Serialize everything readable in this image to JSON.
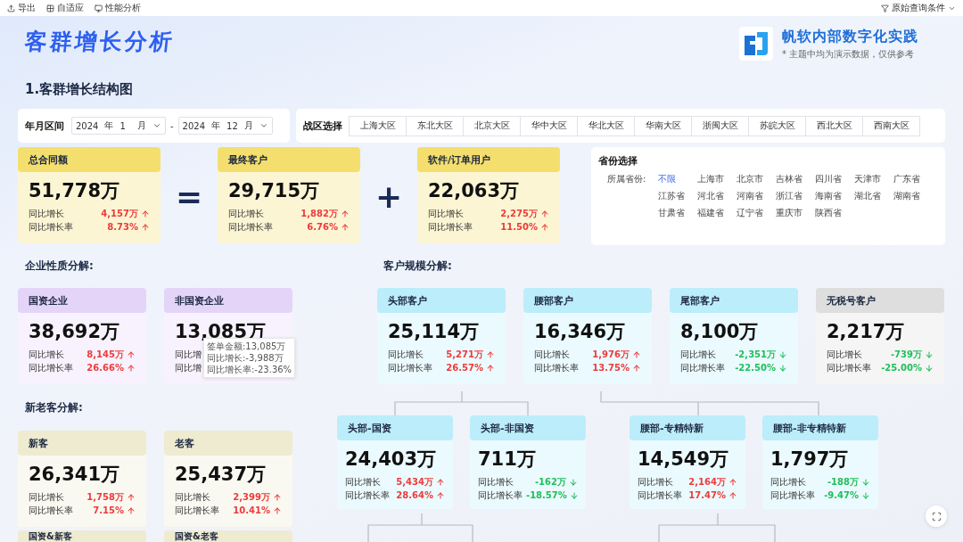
{
  "toolbar": {
    "left": [
      {
        "label": "导出"
      },
      {
        "label": "自适应"
      },
      {
        "label": "性能分析"
      }
    ],
    "right": {
      "label": "原始查询条件"
    }
  },
  "header": {
    "title": "客群增长分析",
    "brand": "帆软内部数字化实践",
    "note": "* 主题中均为演示数据，仅供参考"
  },
  "section_title": "1.客群增长结构图",
  "date_filter": {
    "label": "年月区间",
    "separator": "-",
    "ranges": [
      {
        "year": "2024",
        "year_unit": "年",
        "month": "1",
        "month_unit": "月"
      },
      {
        "year": "2024",
        "year_unit": "年",
        "month": "12",
        "month_unit": "月"
      }
    ]
  },
  "region_filter": {
    "label": "战区选择",
    "options": [
      {
        "label": "上海大区",
        "selected": false
      },
      {
        "label": "东北大区",
        "selected": false
      },
      {
        "label": "北京大区",
        "selected": false
      },
      {
        "label": "华中大区",
        "selected": false
      },
      {
        "label": "华北大区",
        "selected": false
      },
      {
        "label": "华南大区",
        "selected": false
      },
      {
        "label": "浙闽大区",
        "selected": false
      },
      {
        "label": "苏皖大区",
        "selected": false
      },
      {
        "label": "西北大区",
        "selected": false
      },
      {
        "label": "西南大区",
        "selected": false
      }
    ]
  },
  "summary": [
    {
      "kind": "card",
      "title": "总合同额",
      "color": "#f4df6e",
      "value": "51,778万",
      "stats": [
        {
          "label": "同比增长",
          "value": "4,157万",
          "increase": true
        },
        {
          "label": "同比增长率",
          "value": "8.73%",
          "increase": true
        }
      ]
    },
    {
      "kind": "operator",
      "symbol": "="
    },
    {
      "kind": "card",
      "title": "最终客户",
      "color": "#f4df6e",
      "value": "29,715万",
      "stats": [
        {
          "label": "同比增长",
          "value": "1,882万",
          "increase": true
        },
        {
          "label": "同比增长率",
          "value": "6.76%",
          "increase": true
        }
      ]
    },
    {
      "kind": "operator",
      "symbol": "+"
    },
    {
      "kind": "card",
      "title": "软件/订单用户",
      "color": "#f4df6e",
      "value": "22,063万",
      "stats": [
        {
          "label": "同比增长",
          "value": "2,275万",
          "increase": true
        },
        {
          "label": "同比增长率",
          "value": "11.50%",
          "increase": true
        }
      ]
    }
  ],
  "province_filter": {
    "title": "省份选择",
    "label": "所属省份:",
    "options": [
      {
        "label": "不限",
        "selected": true
      },
      {
        "label": "上海市",
        "selected": false
      },
      {
        "label": "北京市",
        "selected": false
      },
      {
        "label": "吉林省",
        "selected": false
      },
      {
        "label": "四川省",
        "selected": false
      },
      {
        "label": "天津市",
        "selected": false
      },
      {
        "label": "广东省",
        "selected": false
      },
      {
        "label": "江苏省",
        "selected": false
      },
      {
        "label": "河北省",
        "selected": false
      },
      {
        "label": "河南省",
        "selected": false
      },
      {
        "label": "浙江省",
        "selected": false
      },
      {
        "label": "海南省",
        "selected": false
      },
      {
        "label": "湖北省",
        "selected": false
      },
      {
        "label": "湖南省",
        "selected": false
      },
      {
        "label": "甘肃省",
        "selected": false
      },
      {
        "label": "福建省",
        "selected": false
      },
      {
        "label": "辽宁省",
        "selected": false
      },
      {
        "label": "重庆市",
        "selected": false
      },
      {
        "label": "陕西省",
        "selected": false
      }
    ]
  },
  "enterprise_nature": {
    "title": "企业性质分解:",
    "cards": [
      {
        "title": "国资企业",
        "color": "#e4d5f8",
        "value": "38,692万",
        "stats": [
          {
            "label": "同比增长",
            "value": "8,145万",
            "increase": true
          },
          {
            "label": "同比增长率",
            "value": "26.66%",
            "increase": true
          }
        ]
      },
      {
        "title": "非国资企业",
        "color": "#e4d5f8",
        "value": "13,085万",
        "stats": [
          {
            "label": "同比增"
          },
          {
            "label": "同比增"
          }
        ],
        "tooltip": {
          "lines": [
            "签单金额:13,085万",
            "同比增长:-3,988万",
            "同比增长率:-23.36%"
          ]
        }
      }
    ]
  },
  "new_old": {
    "title": "新老客分解:",
    "cards": [
      {
        "title": "新客",
        "color": "#eeebd0",
        "value": "26,341万",
        "stats": [
          {
            "label": "同比增长",
            "value": "1,758万",
            "increase": true
          },
          {
            "label": "同比增长率",
            "value": "7.15%",
            "increase": true
          }
        ]
      },
      {
        "title": "老客",
        "color": "#eeebd0",
        "value": "25,437万",
        "stats": [
          {
            "label": "同比增长",
            "value": "2,399万",
            "increase": true
          },
          {
            "label": "同比增长率",
            "value": "10.41%",
            "increase": true
          }
        ]
      }
    ],
    "next_cards": [
      {
        "title": "国资&新客",
        "color": "#eeebd0"
      },
      {
        "title": "国资&老客",
        "color": "#eeebd0"
      }
    ]
  },
  "customer_scale": {
    "title": "客户规模分解:",
    "cards": [
      {
        "title": "头部客户",
        "color": "#bcedfa",
        "value": "25,114万",
        "stats": [
          {
            "label": "同比增长",
            "value": "5,271万",
            "increase": true
          },
          {
            "label": "同比增长率",
            "value": "26.57%",
            "increase": true
          }
        ],
        "children": [
          {
            "title": "头部-国资",
            "color": "#bcedfa",
            "value": "24,403万",
            "stats": [
              {
                "label": "同比增长",
                "value": "5,434万",
                "increase": true
              },
              {
                "label": "同比增长率",
                "value": "28.64%",
                "increase": true
              }
            ]
          },
          {
            "title": "头部-非国资",
            "color": "#bcedfa",
            "value": "711万",
            "stats": [
              {
                "label": "同比增长",
                "value": "-162万",
                "increase": false
              },
              {
                "label": "同比增长率",
                "value": "-18.57%",
                "increase": false
              }
            ]
          }
        ]
      },
      {
        "title": "腰部客户",
        "color": "#bcedfa",
        "value": "16,346万",
        "stats": [
          {
            "label": "同比增长",
            "value": "1,976万",
            "increase": true
          },
          {
            "label": "同比增长率",
            "value": "13.75%",
            "increase": true
          }
        ],
        "children": [
          {
            "title": "腰部-专精特新",
            "color": "#bcedfa",
            "value": "14,549万",
            "stats": [
              {
                "label": "同比增长",
                "value": "2,164万",
                "increase": true
              },
              {
                "label": "同比增长率",
                "value": "17.47%",
                "increase": true
              }
            ]
          },
          {
            "title": "腰部-非专精特新",
            "color": "#bcedfa",
            "value": "1,797万",
            "stats": [
              {
                "label": "同比增长",
                "value": "-188万",
                "increase": false
              },
              {
                "label": "同比增长率",
                "value": "-9.47%",
                "increase": false
              }
            ]
          }
        ]
      },
      {
        "title": "尾部客户",
        "color": "#bcedfa",
        "value": "8,100万",
        "stats": [
          {
            "label": "同比增长",
            "value": "-2,351万",
            "increase": false
          },
          {
            "label": "同比增长率",
            "value": "-22.50%",
            "increase": false
          }
        ]
      },
      {
        "title": "无税号客户",
        "color": "#dedede",
        "value": "2,217万",
        "stats": [
          {
            "label": "同比增长",
            "value": "-739万",
            "increase": false
          },
          {
            "label": "同比增长率",
            "value": "-25.00%",
            "increase": false
          }
        ]
      }
    ]
  }
}
